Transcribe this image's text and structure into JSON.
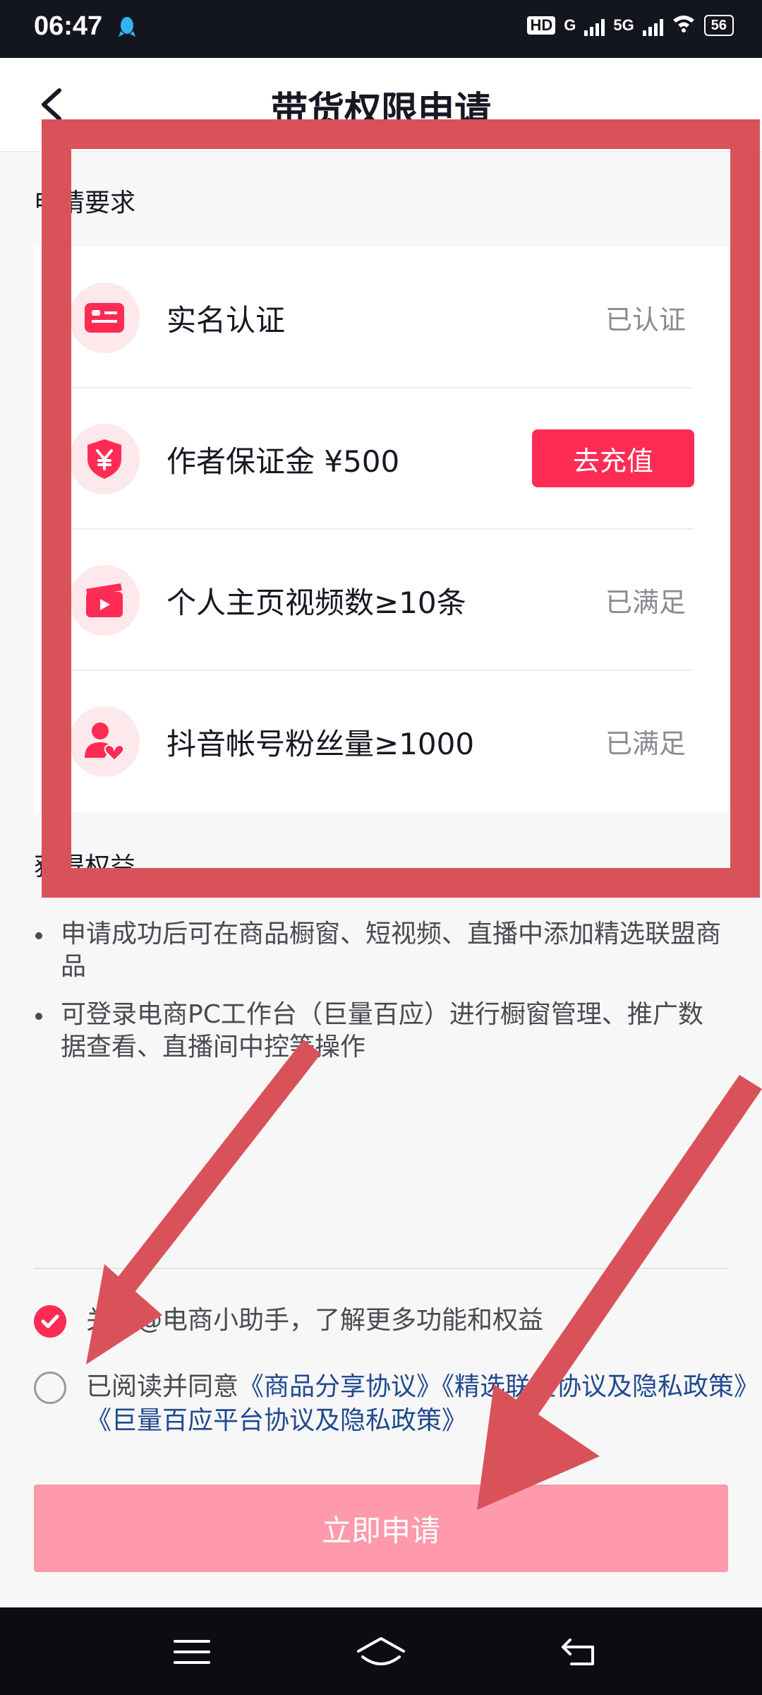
{
  "status_bar": {
    "time": "06:47",
    "hd": "HD",
    "net_g": "G",
    "net_5g": "5G",
    "battery": "56"
  },
  "header": {
    "title": "带货权限申请"
  },
  "requirements": {
    "section_label": "申请要求",
    "items": [
      {
        "icon": "id-card-icon",
        "label": "实名认证",
        "status": "已认证"
      },
      {
        "icon": "shield-yen-icon",
        "label": "作者保证金 ¥500",
        "action": "去充值"
      },
      {
        "icon": "video-clapper-icon",
        "label": "个人主页视频数≥10条",
        "status": "已满足"
      },
      {
        "icon": "user-heart-icon",
        "label": "抖音帐号粉丝量≥1000",
        "status": "已满足"
      }
    ]
  },
  "benefits": {
    "section_label": "获得权益",
    "items": [
      "申请成功后可在商品橱窗、短视频、直播中添加精选联盟商品",
      "可登录电商PC工作台（巨量百应）进行橱窗管理、推广数据查看、直播间中控等操作"
    ]
  },
  "agreements": {
    "follow_text": "关注@电商小助手，了解更多功能和权益",
    "follow_checked": true,
    "agree_prefix": "已阅读并同意",
    "link1": "《商品分享协议》",
    "link2": "《精选联盟协议及隐私政策》",
    "link3": "《巨量百应平台协议及隐私政策》",
    "agree_checked": false
  },
  "apply_button": {
    "label": "立即申请"
  },
  "colors": {
    "accent": "#fe2c55",
    "disabled_button": "#fe9aab",
    "annotation": "#d9525a"
  }
}
